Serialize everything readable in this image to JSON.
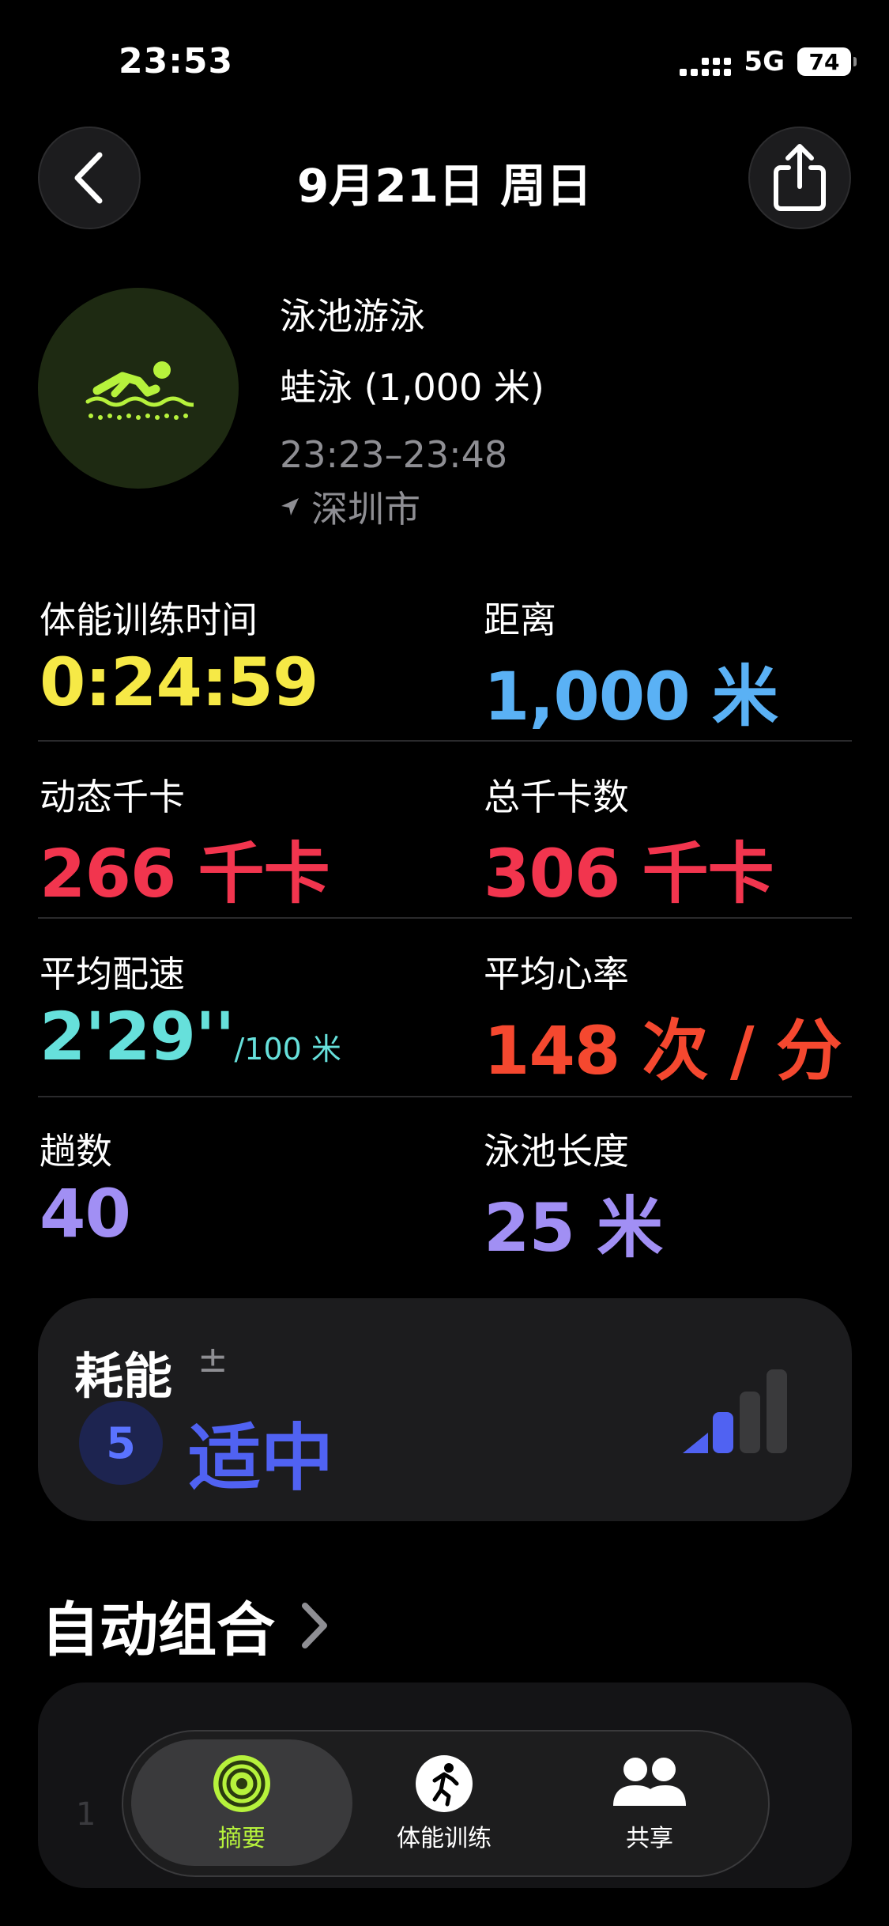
{
  "status": {
    "time": "23:53",
    "network": "5G",
    "battery": "74"
  },
  "nav": {
    "title": "9月21日 周日"
  },
  "workout": {
    "type": "泳池游泳",
    "stroke": "蛙泳 (1,000 米)",
    "time_range": "23:23–23:48",
    "location": "深圳市"
  },
  "metrics": [
    {
      "label": "体能训练时间",
      "value": "0:24:59",
      "unit": "",
      "color": "#f6e946"
    },
    {
      "label": "距离",
      "value": "1,000",
      "unit": "米",
      "color": "#5ab1f5"
    },
    {
      "label": "动态千卡",
      "value": "266",
      "unit": "千卡",
      "color": "#f2354e"
    },
    {
      "label": "总千卡数",
      "value": "306",
      "unit": "千卡",
      "color": "#f2354e"
    },
    {
      "label": "平均配速",
      "value": "2'29''",
      "unit": "/100 米",
      "color": "#66e0db"
    },
    {
      "label": "平均心率",
      "value": "148",
      "unit": "次 / 分",
      "color": "#f5482f"
    },
    {
      "label": "趟数",
      "value": "40",
      "unit": "",
      "color": "#a18ff4"
    },
    {
      "label": "泳池长度",
      "value": "25",
      "unit": "米",
      "color": "#a18ff4"
    }
  ],
  "effort": {
    "title": "耗能",
    "adjust": "±",
    "score": "5",
    "level": "适中",
    "bars_filled": 2,
    "bars_total": 4,
    "color": "#5062f2"
  },
  "section": {
    "title": "自动组合"
  },
  "sets_preview": {
    "index": "1"
  },
  "tabs": [
    {
      "label": "摘要",
      "icon": "activity-rings-icon",
      "active": true
    },
    {
      "label": "体能训练",
      "icon": "runner-icon",
      "active": false
    },
    {
      "label": "共享",
      "icon": "people-icon",
      "active": false
    }
  ]
}
